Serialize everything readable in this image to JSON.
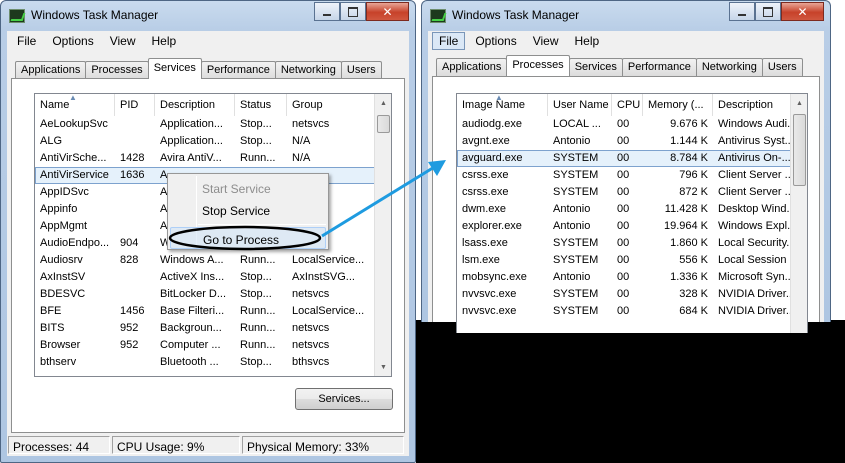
{
  "left_window": {
    "title": "Windows Task Manager",
    "menu": [
      "File",
      "Options",
      "View",
      "Help"
    ],
    "tabs": [
      "Applications",
      "Processes",
      "Services",
      "Performance",
      "Networking",
      "Users"
    ],
    "active_tab": "Services",
    "columns": [
      "Name",
      "PID",
      "Description",
      "Status",
      "Group"
    ],
    "rows": [
      {
        "name": "AeLookupSvc",
        "pid": "",
        "desc": "Application...",
        "status": "Stop...",
        "group": "netsvcs"
      },
      {
        "name": "ALG",
        "pid": "",
        "desc": "Application...",
        "status": "Stop...",
        "group": "N/A"
      },
      {
        "name": "AntiVirSche...",
        "pid": "1428",
        "desc": "Avira AntiV...",
        "status": "Runn...",
        "group": "N/A"
      },
      {
        "name": "AntiVirService",
        "pid": "1636",
        "desc": "A",
        "status": "",
        "group": "",
        "selected": true
      },
      {
        "name": "AppIDSvc",
        "pid": "",
        "desc": "A",
        "status": "",
        "group": "ervic..."
      },
      {
        "name": "Appinfo",
        "pid": "",
        "desc": "A",
        "status": "",
        "group": ""
      },
      {
        "name": "AppMgmt",
        "pid": "",
        "desc": "A",
        "status": "",
        "group": ""
      },
      {
        "name": "AudioEndpo...",
        "pid": "904",
        "desc": "W",
        "status": "",
        "group": "...ste..."
      },
      {
        "name": "Audiosrv",
        "pid": "828",
        "desc": "Windows A...",
        "status": "Runn...",
        "group": "LocalService..."
      },
      {
        "name": "AxInstSV",
        "pid": "",
        "desc": "ActiveX Ins...",
        "status": "Stop...",
        "group": "AxInstSVG..."
      },
      {
        "name": "BDESVC",
        "pid": "",
        "desc": "BitLocker D...",
        "status": "Stop...",
        "group": "netsvcs"
      },
      {
        "name": "BFE",
        "pid": "1456",
        "desc": "Base Filteri...",
        "status": "Runn...",
        "group": "LocalService..."
      },
      {
        "name": "BITS",
        "pid": "952",
        "desc": "Backgroun...",
        "status": "Runn...",
        "group": "netsvcs"
      },
      {
        "name": "Browser",
        "pid": "952",
        "desc": "Computer ...",
        "status": "Runn...",
        "group": "netsvcs"
      },
      {
        "name": "bthserv",
        "pid": "",
        "desc": "Bluetooth ...",
        "status": "Stop...",
        "group": "bthsvcs"
      }
    ],
    "services_button": "Services...",
    "status": {
      "processes": "Processes: 44",
      "cpu": "CPU Usage: 9%",
      "memory": "Physical Memory: 33%"
    }
  },
  "context_menu": {
    "items": [
      "Start Service",
      "Stop Service",
      "Go to Process"
    ],
    "disabled": "Start Service",
    "circled": "Go to Process"
  },
  "right_window": {
    "title": "Windows Task Manager",
    "menu": [
      "File",
      "Options",
      "View",
      "Help"
    ],
    "tabs": [
      "Applications",
      "Processes",
      "Services",
      "Performance",
      "Networking",
      "Users"
    ],
    "active_tab": "Processes",
    "columns": [
      "Image Name",
      "User Name",
      "CPU",
      "Memory (...",
      "Description"
    ],
    "rows": [
      {
        "image": "audiodg.exe",
        "user": "LOCAL ...",
        "cpu": "00",
        "mem": "9.676 K",
        "desc": "Windows Audi..."
      },
      {
        "image": "avgnt.exe",
        "user": "Antonio",
        "cpu": "00",
        "mem": "1.144 K",
        "desc": "Antivirus Syst..."
      },
      {
        "image": "avguard.exe",
        "user": "SYSTEM",
        "cpu": "00",
        "mem": "8.784 K",
        "desc": "Antivirus On-...",
        "selected": true
      },
      {
        "image": "csrss.exe",
        "user": "SYSTEM",
        "cpu": "00",
        "mem": "796 K",
        "desc": "Client Server ..."
      },
      {
        "image": "csrss.exe",
        "user": "SYSTEM",
        "cpu": "00",
        "mem": "872 K",
        "desc": "Client Server ..."
      },
      {
        "image": "dwm.exe",
        "user": "Antonio",
        "cpu": "00",
        "mem": "11.428 K",
        "desc": "Desktop Wind..."
      },
      {
        "image": "explorer.exe",
        "user": "Antonio",
        "cpu": "00",
        "mem": "19.964 K",
        "desc": "Windows Expl..."
      },
      {
        "image": "lsass.exe",
        "user": "SYSTEM",
        "cpu": "00",
        "mem": "1.860 K",
        "desc": "Local Security..."
      },
      {
        "image": "lsm.exe",
        "user": "SYSTEM",
        "cpu": "00",
        "mem": "556 K",
        "desc": "Local Session ..."
      },
      {
        "image": "mobsync.exe",
        "user": "Antonio",
        "cpu": "00",
        "mem": "1.336 K",
        "desc": "Microsoft Syn..."
      },
      {
        "image": "nvvsvc.exe",
        "user": "SYSTEM",
        "cpu": "00",
        "mem": "328 K",
        "desc": "NVIDIA Driver..."
      },
      {
        "image": "nvvsvc.exe",
        "user": "SYSTEM",
        "cpu": "00",
        "mem": "684 K",
        "desc": "NVIDIA Driver..."
      }
    ]
  },
  "colors": {
    "arrow": "#1e9be0",
    "circle": "#000000",
    "selection": "#e5f1fb",
    "close_button": "#c7422a"
  },
  "icons": [
    "task-manager-icon",
    "minimize-icon",
    "maximize-icon",
    "close-icon",
    "sort-arrow-icon",
    "scroll-up-icon",
    "scroll-down-icon"
  ]
}
